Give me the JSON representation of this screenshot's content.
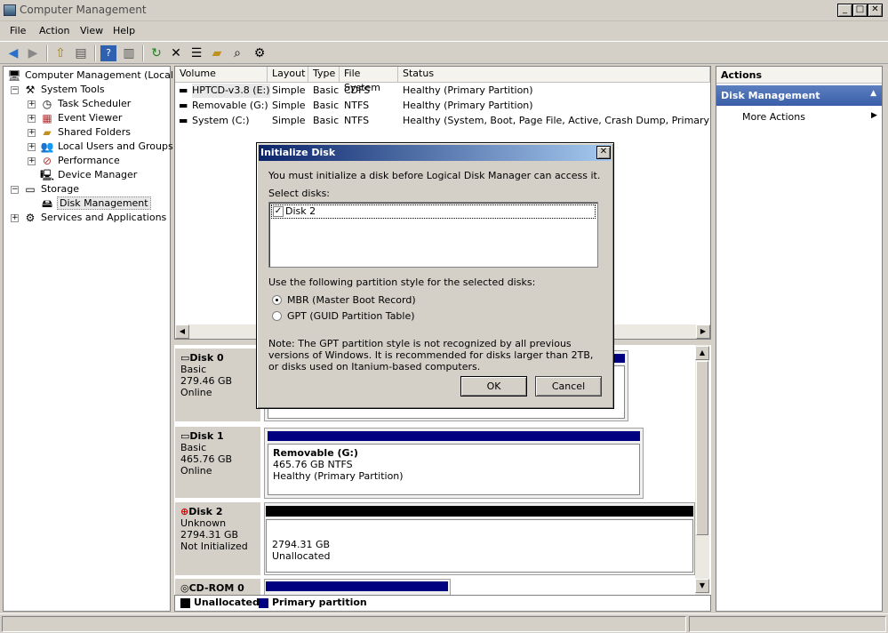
{
  "window": {
    "title": "Computer Management"
  },
  "menu": [
    "File",
    "Action",
    "View",
    "Help"
  ],
  "tree": [
    {
      "label": "Computer Management (Local)",
      "icon": "computer-icon"
    },
    {
      "label": "System Tools",
      "icon": "tools-icon"
    },
    {
      "label": "Task Scheduler",
      "icon": "clock-icon"
    },
    {
      "label": "Event Viewer",
      "icon": "event-viewer-icon"
    },
    {
      "label": "Shared Folders",
      "icon": "shared-folder-icon"
    },
    {
      "label": "Local Users and Groups",
      "icon": "users-icon"
    },
    {
      "label": "Performance",
      "icon": "performance-icon"
    },
    {
      "label": "Device Manager",
      "icon": "device-manager-icon"
    },
    {
      "label": "Storage",
      "icon": "storage-icon"
    },
    {
      "label": "Disk Management",
      "icon": "disk-management-icon"
    },
    {
      "label": "Services and Applications",
      "icon": "services-icon"
    }
  ],
  "volumes": {
    "columns": [
      "Volume",
      "Layout",
      "Type",
      "File System",
      "Status"
    ],
    "rows": [
      [
        "HPTCD-v3.8 (E:)",
        "Simple",
        "Basic",
        "CDFS",
        "Healthy (Primary Partition)"
      ],
      [
        "Removable (G:)",
        "Simple",
        "Basic",
        "NTFS",
        "Healthy (Primary Partition)"
      ],
      [
        "System (C:)",
        "Simple",
        "Basic",
        "NTFS",
        "Healthy (System, Boot, Page File, Active, Crash Dump, Primary Partition)"
      ]
    ]
  },
  "disks": [
    {
      "name": "Disk 0",
      "type": "Basic",
      "size": "279.46 GB",
      "state": "Online"
    },
    {
      "name": "Disk 1",
      "type": "Basic",
      "size": "465.76 GB",
      "state": "Online",
      "partition": {
        "title": "Removable  (G:)",
        "size": "465.76 GB NTFS",
        "status": "Healthy (Primary Partition)"
      }
    },
    {
      "name": "Disk 2",
      "type": "Unknown",
      "size": "2794.31 GB",
      "state": "Not Initialized",
      "partition": {
        "size": "2794.31 GB",
        "status": "Unallocated"
      }
    },
    {
      "name": "CD-ROM 0"
    }
  ],
  "legend": [
    "Unallocated",
    "Primary partition"
  ],
  "colors": {
    "unallocated": "#000000",
    "primary": "#000080",
    "title_bar": "#0a246a"
  },
  "actions": {
    "header": "Actions",
    "section": "Disk Management",
    "more": "More Actions"
  },
  "dialog": {
    "title": "Initialize Disk",
    "intro": "You must initialize a disk before Logical Disk Manager can access it.",
    "select_label": "Select disks:",
    "disk_item": "Disk 2",
    "style_label": "Use the following partition style for the selected disks:",
    "mbr": "MBR (Master Boot Record)",
    "gpt": "GPT (GUID Partition Table)",
    "note": "Note: The GPT partition style is not recognized by all previous versions of Windows. It is recommended for disks larger than 2TB, or disks used on Itanium-based computers.",
    "ok": "OK",
    "cancel": "Cancel"
  }
}
